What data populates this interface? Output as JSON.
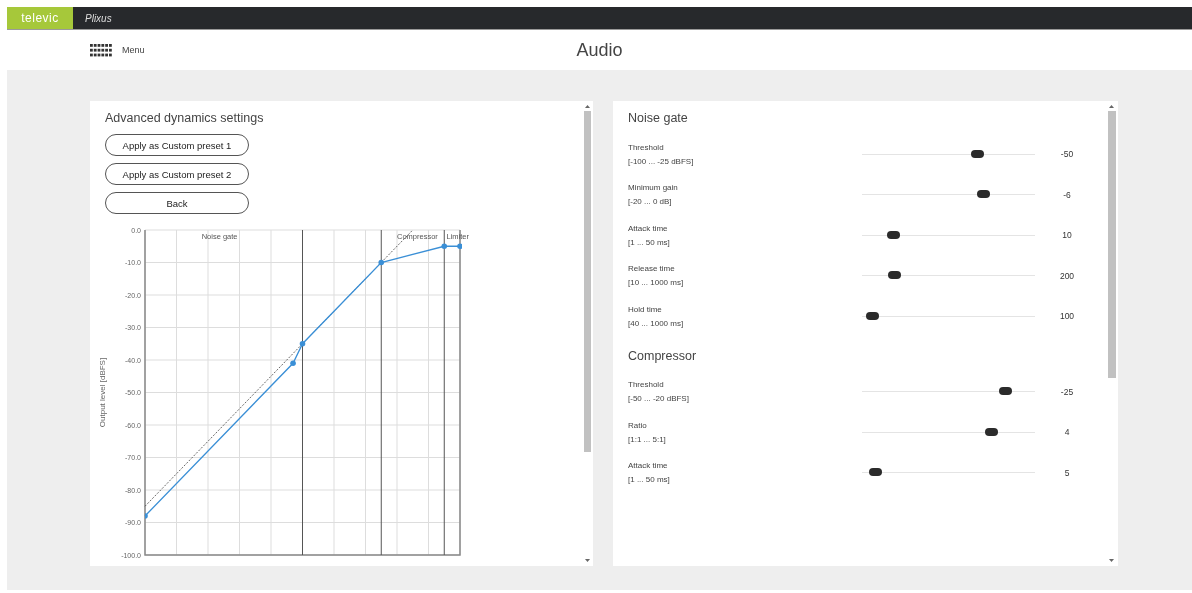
{
  "topbar": {
    "logo": "televic",
    "product": "Plixus"
  },
  "header": {
    "menu_label": "Menu",
    "title": "Audio"
  },
  "advanced": {
    "title": "Advanced dynamics settings",
    "buttons": [
      "Apply as Custom preset 1",
      "Apply as Custom preset 2",
      "Back"
    ],
    "graph": {
      "y_title": "Output level  [dBFS]",
      "y_ticks": [
        "0.0",
        "-10.0",
        "-20.0",
        "-30.0",
        "-40.0",
        "-50.0",
        "-60.0",
        "-70.0",
        "-80.0",
        "-90.0",
        "-100.0"
      ],
      "region_labels": [
        "Noise gate",
        "Compressor",
        "Limiter"
      ]
    }
  },
  "sections": [
    {
      "title": "Noise gate",
      "settings": [
        {
          "label": "Threshold",
          "range": "[-100 ... -25 dBFS]",
          "level": 0.67,
          "value": "-50"
        },
        {
          "label": "Minimum gain",
          "range": "[-20 ... 0 dB]",
          "level": 0.7,
          "value": "-6"
        },
        {
          "label": "Attack time",
          "range": "[1 ... 50 ms]",
          "level": 0.18,
          "value": "10"
        },
        {
          "label": "Release time",
          "range": "[10 ... 1000 ms]",
          "level": 0.19,
          "value": "200"
        },
        {
          "label": "Hold time",
          "range": "[40 ... 1000 ms]",
          "level": 0.06,
          "value": "100"
        }
      ]
    },
    {
      "title": "Compressor",
      "settings": [
        {
          "label": "Threshold",
          "range": "[-50 ... -20 dBFS]",
          "level": 0.83,
          "value": "-25"
        },
        {
          "label": "Ratio",
          "range": "[1:1 ... 5:1]",
          "level": 0.75,
          "value": "4"
        },
        {
          "label": "Attack time",
          "range": "[1 ... 50 ms]",
          "level": 0.08,
          "value": "5"
        }
      ]
    }
  ]
}
